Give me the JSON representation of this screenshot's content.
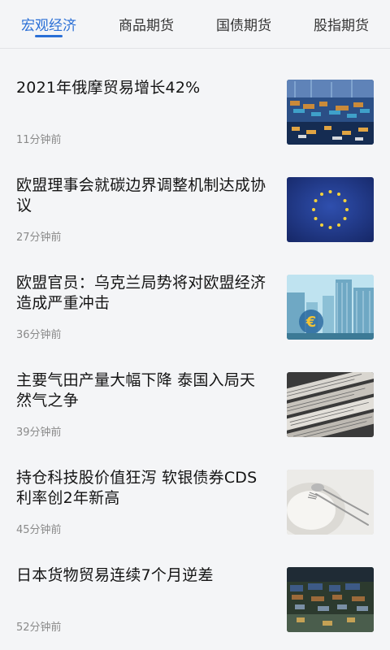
{
  "tabs": [
    {
      "label": "宏观经济",
      "active": true
    },
    {
      "label": "商品期货",
      "active": false
    },
    {
      "label": "国债期货",
      "active": false
    },
    {
      "label": "股指期货",
      "active": false
    }
  ],
  "colors": {
    "accent": "#2a6fd6",
    "background": "#f4f5f7"
  },
  "news": [
    {
      "title": "2021年俄摩贸易增长42%",
      "time": "11分钟前",
      "image": "port-containers"
    },
    {
      "title": "欧盟理事会就碳边界调整机制达成协议",
      "time": "27分钟前",
      "image": "eu-flag"
    },
    {
      "title": "欧盟官员：乌克兰局势将对欧盟经济造成严重冲击",
      "time": "36分钟前",
      "image": "euro-skyline"
    },
    {
      "title": "主要气田产量大幅下降 泰国入局天然气之争",
      "time": "39分钟前",
      "image": "newspapers"
    },
    {
      "title": "持仓科技股价值狂泻 软银债券CDS利率创2年新高",
      "time": "45分钟前",
      "image": "plate-fork"
    },
    {
      "title": "日本货物贸易连续7个月逆差",
      "time": "52分钟前",
      "image": "port-aerial"
    }
  ]
}
